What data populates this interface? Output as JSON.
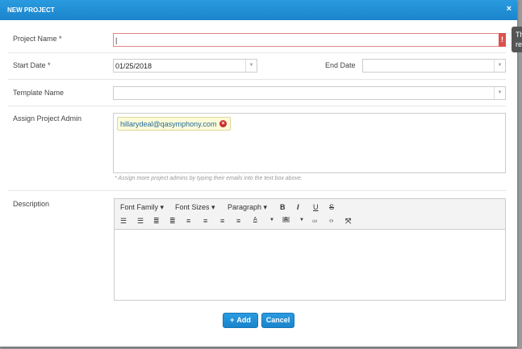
{
  "dialog": {
    "title": "NEW PROJECT",
    "close": "×"
  },
  "form": {
    "project_name": {
      "label": "Project Name *",
      "value": "|",
      "error_icon": "!",
      "tooltip_line1": "Th",
      "tooltip_line2": "re"
    },
    "start_date": {
      "label": "Start Date *",
      "value": "01/25/2018"
    },
    "end_date": {
      "label": "End Date",
      "value": ""
    },
    "template_name": {
      "label": "Template Name",
      "value": ""
    },
    "assign_admin": {
      "label": "Assign Project Admin",
      "tags": [
        "hillarydeal@qasymphony.com"
      ],
      "hint": "* Assign more project admins by typing their emails into the text box above."
    },
    "description": {
      "label": "Description",
      "toolbar": {
        "font_family": "Font Family ▾",
        "font_sizes": "Font Sizes ▾",
        "paragraph": "Paragraph ▾",
        "bold": "B",
        "italic": "I",
        "underline": "U",
        "strike": "S"
      }
    }
  },
  "buttons": {
    "add": "Add",
    "add_icon": "+",
    "cancel": "Cancel"
  },
  "colors": {
    "header": "#1f8fd6",
    "error": "#d9534f",
    "tag_bg": "#fdfbd8"
  }
}
